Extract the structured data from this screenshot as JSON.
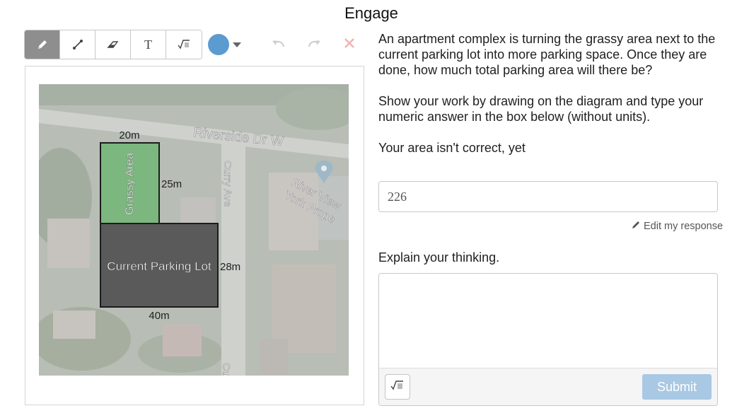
{
  "page": {
    "title": "Engage"
  },
  "toolbar": {
    "tools": [
      {
        "name": "pencil-icon",
        "active": true
      },
      {
        "name": "line-icon",
        "active": false
      },
      {
        "name": "eraser-icon",
        "active": false
      },
      {
        "name": "text-icon",
        "label": "T",
        "active": false
      },
      {
        "name": "math-icon",
        "active": false
      }
    ],
    "color": "#5b9bd0",
    "undo_icon": "undo-icon",
    "redo_icon": "redo-icon",
    "clear_icon": "close-icon"
  },
  "diagram": {
    "street_name": "Riverside Dr W",
    "side_street": "Curry Ave",
    "place_label_1": "River View",
    "place_label_2": "York Prope",
    "lower_street": "Cu",
    "grassy": {
      "label": "Grassy Area",
      "width_label": "20m",
      "height_label": "25m",
      "color": "#7bb77f"
    },
    "parking": {
      "label": "Current Parking Lot",
      "width_label": "40m",
      "height_label": "28m",
      "color": "#5a5a5a"
    }
  },
  "question": {
    "paragraph_1": "An apartment complex is turning the grassy area next to the current parking lot into more parking space. Once they are done, how much total parking area will there be?",
    "paragraph_2": "Show your work by drawing on the diagram and type your numeric answer in the box below (without units).",
    "feedback": "Your area isn't correct, yet"
  },
  "answer": {
    "value": "226"
  },
  "edit_link": "Edit my response",
  "explain": {
    "label": "Explain your thinking.",
    "value": "",
    "submit_label": "Submit",
    "sqrt_symbol": "√"
  }
}
